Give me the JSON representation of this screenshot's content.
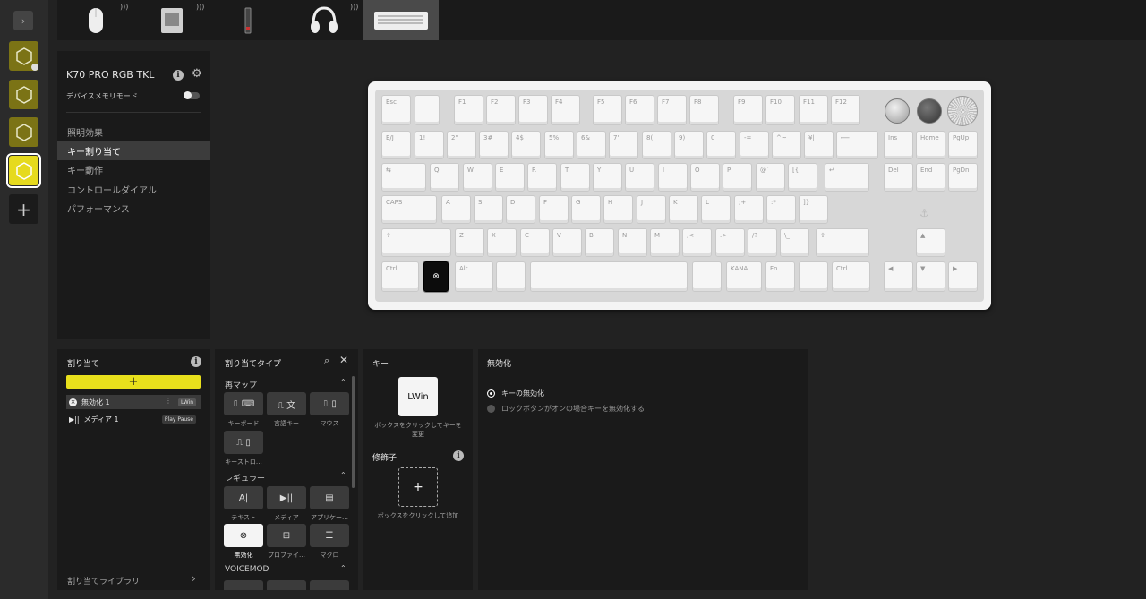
{
  "device_name": "K70 PRO RGB TKL",
  "device_memory_mode_label": "デバイスメモリモード",
  "device_menu": [
    {
      "label": "照明効果"
    },
    {
      "label": "キー割り当て"
    },
    {
      "label": "キー動作"
    },
    {
      "label": "コントロールダイアル"
    },
    {
      "label": "パフォーマンス"
    }
  ],
  "devices": [
    {
      "icon": "mouse-icon"
    },
    {
      "icon": "wireless-dongle-icon"
    },
    {
      "icon": "usb-receiver-icon"
    },
    {
      "icon": "headset-icon"
    },
    {
      "icon": "keyboard-icon"
    }
  ],
  "keyboard": {
    "row0": [
      "Esc",
      "",
      "F1",
      "F2",
      "F3",
      "F4",
      "F5",
      "F6",
      "F7",
      "F8",
      "F9",
      "F10",
      "F11",
      "F12"
    ],
    "row1": [
      "E/J",
      "1!",
      "2\"",
      "3#",
      "4$",
      "5%",
      "6&",
      "7'",
      "8(",
      "9)",
      "0",
      "-=",
      "^~",
      "¥|",
      "⟵",
      "Ins",
      "Home",
      "PgUp"
    ],
    "row2": [
      "⇆",
      "Q",
      "W",
      "E",
      "R",
      "T",
      "Y",
      "U",
      "I",
      "O",
      "P",
      "@`",
      "[{",
      "↵",
      "Del",
      "End",
      "PgDn"
    ],
    "row3": [
      "CAPS",
      "A",
      "S",
      "D",
      "F",
      "G",
      "H",
      "J",
      "K",
      "L",
      ";+",
      ":*",
      "]}"
    ],
    "row4": [
      "⇧",
      "Z",
      "X",
      "C",
      "V",
      "B",
      "N",
      "M",
      ",<",
      ".>",
      "/?",
      "\\_",
      "⇧",
      "▲"
    ],
    "row5": [
      "Ctrl",
      "⊗",
      "Alt",
      "",
      "",
      "",
      "KANA",
      "Fn",
      "",
      "Ctrl",
      "◀",
      "▼",
      "▶"
    ]
  },
  "assign_panel": {
    "title": "割り当て",
    "add_symbol": "+",
    "items": [
      {
        "label": "無効化 1",
        "tag": "LWin"
      },
      {
        "label": "メディア 1",
        "tag": "Play Pause"
      }
    ],
    "library_label": "割り当てライブラリ",
    "library_chevron": "›"
  },
  "types_panel": {
    "title": "割り当てタイプ",
    "sections": [
      {
        "label": "再マップ",
        "tiles": [
          {
            "label": "キーボード",
            "icon": "keyboard-icon"
          },
          {
            "label": "言語キー",
            "icon": "language-icon"
          },
          {
            "label": "マウス",
            "icon": "mouse-icon"
          },
          {
            "label": "キーストロ…",
            "icon": "keystroke-icon"
          }
        ]
      },
      {
        "label": "レギュラー",
        "tiles": [
          {
            "label": "テキスト",
            "icon": "text-icon"
          },
          {
            "label": "メディア",
            "icon": "media-icon"
          },
          {
            "label": "アプリケー…",
            "icon": "app-icon"
          },
          {
            "label": "無効化",
            "icon": "disable-icon"
          },
          {
            "label": "プロファイ…",
            "icon": "profile-icon"
          },
          {
            "label": "マクロ",
            "icon": "macro-icon"
          }
        ]
      },
      {
        "label": "VOICEMOD",
        "tiles": []
      }
    ]
  },
  "key_panel": {
    "title": "キー",
    "key_value": "LWin",
    "key_caption": "ボックスをクリックしてキーを変更",
    "modifier_title": "修飾子",
    "modifier_symbol": "+",
    "modifier_caption": "ボックスをクリックして追加"
  },
  "disable_panel": {
    "title": "無効化",
    "options": [
      {
        "label": "キーの無効化",
        "selected": true
      },
      {
        "label": "ロックボタンがオンの場合キーを無効化する",
        "selected": false
      }
    ]
  },
  "colors": {
    "accent": "#e8e01c",
    "profile_inactive": "#7b7315",
    "panel": "#1a1a1a",
    "background": "#222222"
  }
}
